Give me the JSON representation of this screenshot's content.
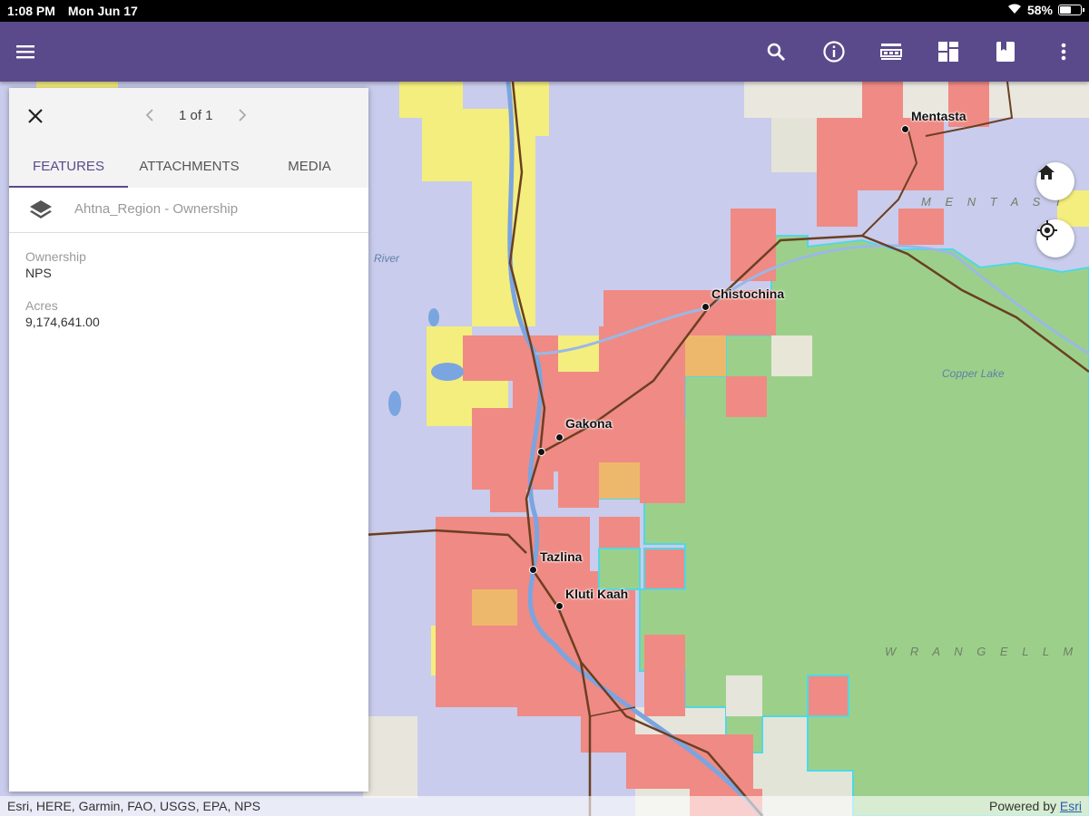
{
  "status_bar": {
    "time": "1:08 PM",
    "date": "Mon Jun 17",
    "battery_text": "58%",
    "battery_level": 0.58
  },
  "app_bar": {
    "color": "#5b4a8b",
    "icons": [
      "menu-icon",
      "search-icon",
      "info-icon",
      "legend-icon",
      "basemap-icon",
      "bookmark-icon",
      "more-icon"
    ]
  },
  "popup": {
    "pager_text": "1 of 1",
    "tabs": [
      {
        "label": "FEATURES",
        "active": true
      },
      {
        "label": "ATTACHMENTS",
        "active": false
      },
      {
        "label": "MEDIA",
        "active": false
      }
    ],
    "layer_name": "Ahtna_Region - Ownership",
    "fields": [
      {
        "label": "Ownership",
        "value": "NPS"
      },
      {
        "label": "Acres",
        "value": "9,174,641.00"
      }
    ]
  },
  "map": {
    "places": [
      "Mentasta",
      "Chistochina",
      "Gakona",
      "Tazlina",
      "Kluti Kaah"
    ],
    "region_labels": [
      "M E N T A S T",
      "W R A N G E L L  M"
    ],
    "water_labels": [
      "Copper Lake",
      "River"
    ],
    "colors": {
      "federal_blm": "#c9ccec",
      "native_private": "#f08a84",
      "state": "#f4ee7e",
      "nps": "#9cd08a",
      "nps_outline": "#4fd8e4",
      "mixed": "#eeb86c"
    },
    "buttons": [
      "home-icon",
      "locate-icon"
    ]
  },
  "attribution": {
    "left": "Esri, HERE, Garmin, FAO, USGS, EPA, NPS",
    "right_prefix": "Powered by ",
    "right_link": "Esri"
  }
}
